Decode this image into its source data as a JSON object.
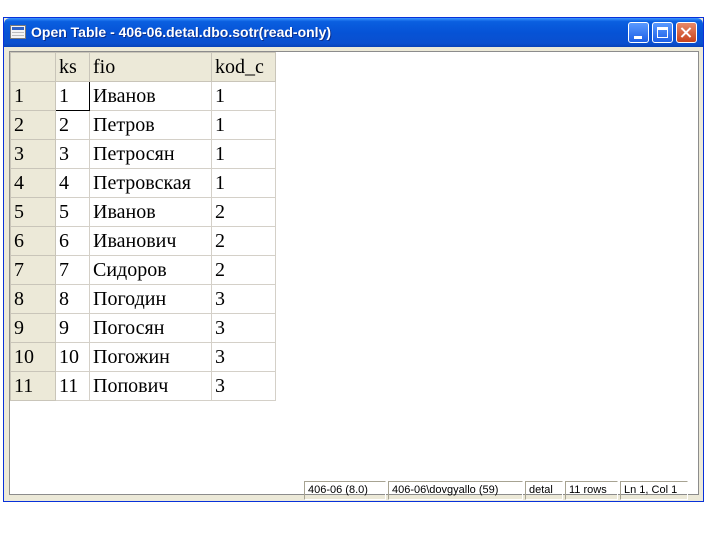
{
  "window": {
    "title": "Open Table - 406-06.detal.dbo.sotr(read-only)"
  },
  "table": {
    "columns": [
      "ks",
      "fio",
      "kod_c"
    ],
    "rows": [
      {
        "num": "1",
        "ks": "1",
        "fio": "Иванов",
        "kod_c": "1"
      },
      {
        "num": "2",
        "ks": "2",
        "fio": "Петров",
        "kod_c": "1"
      },
      {
        "num": "3",
        "ks": "3",
        "fio": "Петросян",
        "kod_c": "1"
      },
      {
        "num": "4",
        "ks": "4",
        "fio": "Петровская",
        "kod_c": "1"
      },
      {
        "num": "5",
        "ks": "5",
        "fio": "Иванов",
        "kod_c": "2"
      },
      {
        "num": "6",
        "ks": "6",
        "fio": "Иванович",
        "kod_c": "2"
      },
      {
        "num": "7",
        "ks": "7",
        "fio": "Сидоров",
        "kod_c": "2"
      },
      {
        "num": "8",
        "ks": "8",
        "fio": "Погодин",
        "kod_c": "3"
      },
      {
        "num": "9",
        "ks": "9",
        "fio": "Погосян",
        "kod_c": "3"
      },
      {
        "num": "10",
        "ks": "10",
        "fio": "Погожин",
        "kod_c": "3"
      },
      {
        "num": "11",
        "ks": "11",
        "fio": "Попович",
        "kod_c": "3"
      }
    ]
  },
  "status": {
    "server": "406-06 (8.0)",
    "user": "406-06\\dovgyallo (59)",
    "database": "detal",
    "rows": "11 rows",
    "position": "Ln 1, Col 1"
  },
  "icons": {
    "title": "table-window-icon",
    "minimize": "minimize-icon",
    "maximize": "maximize-icon",
    "close": "close-icon"
  },
  "colors": {
    "titlebar": "#0653d6",
    "close_button": "#c8431b",
    "window_frame": "#ece9d8"
  }
}
